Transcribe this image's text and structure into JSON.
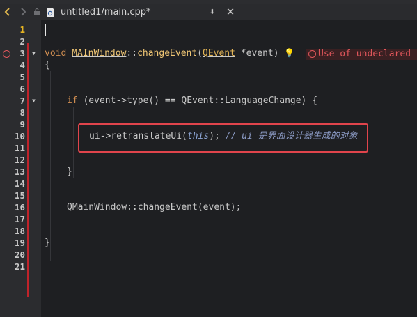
{
  "toolbar": {
    "back_icon": "back-arrow-icon",
    "forward_icon": "forward-arrow-icon",
    "file_title": "untitled1/main.cpp*"
  },
  "gutter": {
    "line_numbers": [
      "1",
      "2",
      "3",
      "4",
      "5",
      "6",
      "7",
      "8",
      "9",
      "10",
      "11",
      "12",
      "13",
      "14",
      "15",
      "16",
      "17",
      "18",
      "19",
      "20",
      "21"
    ]
  },
  "code": {
    "l3_void": "void ",
    "l3_class": "MAInWindow",
    "l3_scope": "::",
    "l3_method": "changeEvent",
    "l3_paren": "(",
    "l3_type": "QEvent",
    "l3_rest": " *event)",
    "l4": "{",
    "l7_if": "if",
    "l7_rest": " (event->type() == QEvent::LanguageChange) {",
    "l10_a": "ui->retranslateUi(",
    "l10_this": "this",
    "l10_b": "); ",
    "l10_comment": "// ui 是界面设计器生成的对象",
    "l13": "}",
    "l16": "QMainWindow::changeEvent(event);",
    "l19": "}"
  },
  "diagnostic": {
    "error_text": "Use of undeclared"
  },
  "colors": {
    "error": "#e0565b",
    "keyword": "#cf8d51",
    "current_line": "#e6b422"
  }
}
